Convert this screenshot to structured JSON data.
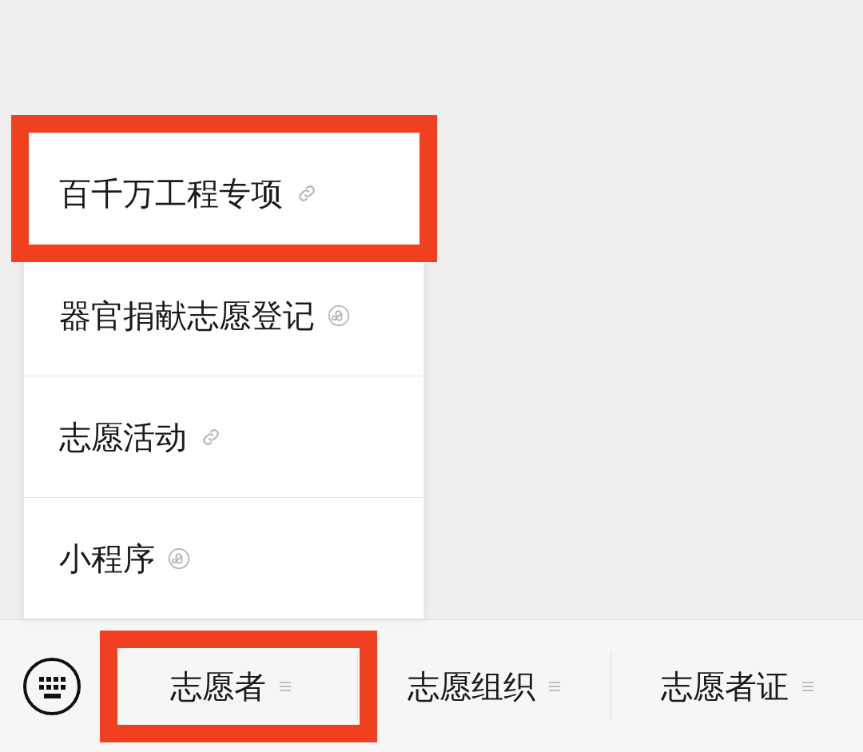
{
  "submenu": {
    "items": [
      {
        "label": "百千万工程专项",
        "kind": "link",
        "highlighted": true
      },
      {
        "label": "器官捐献志愿登记",
        "kind": "miniprogram",
        "highlighted": false
      },
      {
        "label": "志愿活动",
        "kind": "link",
        "highlighted": false
      },
      {
        "label": "小程序",
        "kind": "miniprogram",
        "highlighted": false
      }
    ]
  },
  "menu_bar": {
    "tabs": [
      {
        "label": "志愿者",
        "highlighted": true
      },
      {
        "label": "志愿组织",
        "highlighted": false
      },
      {
        "label": "志愿者证",
        "highlighted": false
      }
    ]
  }
}
